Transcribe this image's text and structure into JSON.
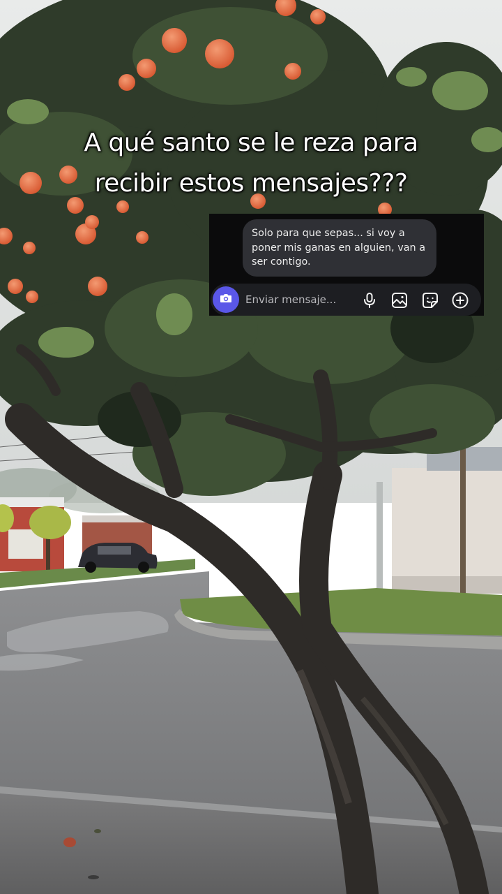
{
  "caption": {
    "line1": "A qué santo se le reza para",
    "line2": "recibir estos mensajes???"
  },
  "chat": {
    "message": "Solo para que sepas... si voy a poner mis ganas en alguien, van a ser contigo.",
    "composer": {
      "placeholder": "Enviar mensaje...",
      "icons": [
        "camera-icon",
        "microphone-icon",
        "image-icon",
        "sticker-icon",
        "plus-icon"
      ]
    },
    "colors": {
      "accent": "#5a57e8",
      "panel": "#0b0b0c",
      "bubble": "#2f3035"
    }
  },
  "background": {
    "description_icons": [
      "orange-tree",
      "wet-street"
    ]
  }
}
